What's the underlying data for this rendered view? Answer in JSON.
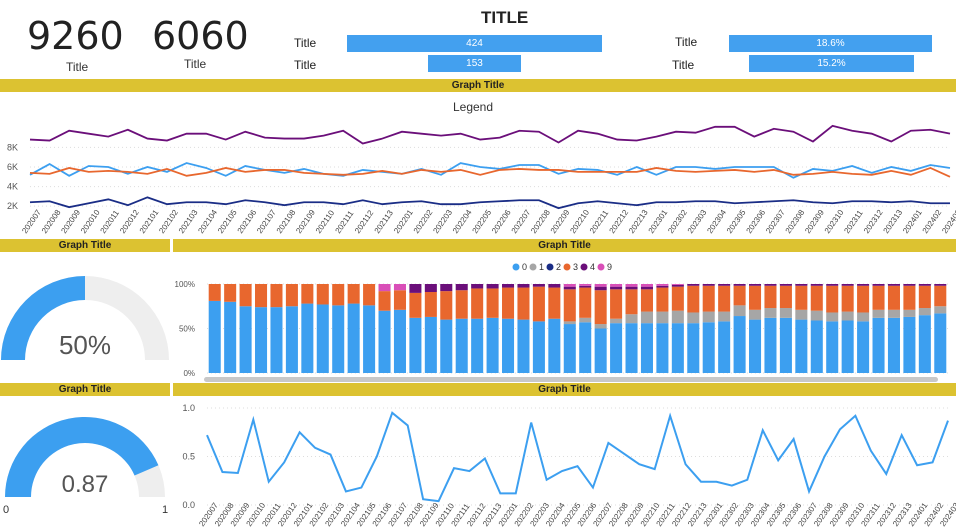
{
  "header": {
    "main_title": "TITLE",
    "kpis": [
      {
        "value": "9260",
        "label": "Title"
      },
      {
        "value": "6060",
        "label": "Title"
      }
    ],
    "metrics": [
      {
        "label": "Title",
        "value_text": "424",
        "share": 0.91
      },
      {
        "label": "Title",
        "value_text": "153",
        "share": 0.33
      },
      {
        "label": "Title",
        "value_text": "18.6%",
        "share": 0.91
      },
      {
        "label": "Title",
        "value_text": "15.2%",
        "share": 0.74
      }
    ]
  },
  "colors": {
    "blue": "#3c9ff0",
    "orange": "#e8672e",
    "navy": "#1a2d86",
    "purple": "#6b0f7a",
    "gray": "#a6a6a6",
    "pink": "#d94fb8",
    "band": "#dcc231"
  },
  "panels": {
    "line_title": "Graph Title",
    "gauge1_title": "Graph Title",
    "stack_title": "Graph Title",
    "gauge2_title": "Graph Title",
    "line2_title": "Graph Title"
  },
  "gauge1": {
    "value": 0.5,
    "label": "50%"
  },
  "gauge2": {
    "value": 0.87,
    "label": "0.87",
    "min_label": "0",
    "max_label": "1"
  },
  "chart_data": [
    {
      "type": "line",
      "legend_title": "Legend",
      "x": [
        "202007",
        "202008",
        "202009",
        "202010",
        "202011",
        "202012",
        "202101",
        "202102",
        "202103",
        "202104",
        "202105",
        "202106",
        "202107",
        "202108",
        "202109",
        "202110",
        "202111",
        "202112",
        "202113",
        "202201",
        "202202",
        "202203",
        "202204",
        "202205",
        "202206",
        "202207",
        "202208",
        "202209",
        "202210",
        "202211",
        "202212",
        "202213",
        "202301",
        "202302",
        "202303",
        "202304",
        "202305",
        "202306",
        "202307",
        "202308",
        "202309",
        "202310",
        "202311",
        "202312",
        "202313",
        "202401",
        "202402",
        "202403"
      ],
      "y_ticks": [
        "2K",
        "4K",
        "6K",
        "8K"
      ],
      "ylim": [
        1200,
        11000
      ],
      "series": [
        {
          "color": "#6b0f7a",
          "values": [
            8800,
            8700,
            9700,
            9400,
            9100,
            9800,
            8900,
            8700,
            9400,
            9400,
            8800,
            9600,
            9000,
            8900,
            8900,
            9200,
            9700,
            8400,
            8900,
            9600,
            9400,
            9200,
            9400,
            8800,
            9000,
            9700,
            9600,
            8500,
            9700,
            9400,
            8800,
            8700,
            9100,
            9600,
            9500,
            10100,
            10100,
            9100,
            9900,
            9600,
            8600,
            10200,
            9700,
            9400,
            8600,
            9700,
            9800,
            9400
          ]
        },
        {
          "color": "#3c9ff0",
          "values": [
            5200,
            6300,
            5100,
            6100,
            6000,
            5300,
            6000,
            5500,
            6400,
            5900,
            5100,
            6100,
            5700,
            5400,
            5800,
            5300,
            5100,
            5700,
            5500,
            5300,
            5800,
            5200,
            6400,
            6000,
            5800,
            6200,
            6200,
            5300,
            5800,
            5700,
            5200,
            6000,
            5200,
            6000,
            6000,
            5800,
            6000,
            6000,
            6000,
            4900,
            5800,
            5600,
            6100,
            5400,
            6000,
            5600,
            6200,
            5900
          ]
        },
        {
          "color": "#e8672e",
          "values": [
            5400,
            5300,
            5900,
            5500,
            5600,
            5500,
            5300,
            5800,
            5100,
            5400,
            5900,
            5500,
            5700,
            5700,
            5400,
            5300,
            5200,
            5300,
            5600,
            5300,
            5700,
            5500,
            5700,
            5200,
            5700,
            5800,
            5700,
            5700,
            5500,
            5500,
            5500,
            5500,
            5900,
            5600,
            5500,
            5600,
            5700,
            5500,
            5700,
            5200,
            5300,
            5500,
            5300,
            5200,
            5600,
            5200,
            5900,
            5000
          ]
        },
        {
          "color": "#1a2d86",
          "values": [
            2400,
            2500,
            1900,
            2300,
            2700,
            2100,
            2900,
            2200,
            2400,
            2400,
            2200,
            2600,
            2400,
            2100,
            2400,
            2400,
            2200,
            2600,
            2200,
            2400,
            2500,
            2200,
            2200,
            2400,
            2500,
            2600,
            2600,
            1800,
            2300,
            2500,
            2300,
            2100,
            2400,
            2400,
            2500,
            2500,
            2300,
            2400,
            2500,
            2600,
            2400,
            2300,
            2500,
            2500,
            2400,
            2500,
            2300,
            2300
          ]
        }
      ]
    },
    {
      "type": "bar",
      "stacked": true,
      "legend": [
        "0",
        "1",
        "2",
        "3",
        "4",
        "9"
      ],
      "legend_colors": [
        "#3c9ff0",
        "#a6a6a6",
        "#1a2d86",
        "#e8672e",
        "#6b0f7a",
        "#d94fb8"
      ],
      "y_ticks": [
        "0%",
        "50%",
        "100%"
      ],
      "ylim": [
        0,
        100
      ],
      "series": [
        {
          "name": "0",
          "values": [
            81,
            80,
            75,
            74,
            74,
            75,
            78,
            77,
            76,
            78,
            76,
            70,
            71,
            62,
            63,
            60,
            61,
            61,
            62,
            61,
            60,
            58,
            61,
            55,
            57,
            50,
            56,
            56,
            56,
            56,
            56,
            56,
            57,
            58,
            64,
            60,
            62,
            62,
            60,
            59,
            58,
            59,
            58,
            62,
            62,
            63,
            65,
            67
          ]
        },
        {
          "name": "1",
          "values": [
            0,
            0,
            0,
            0,
            0,
            0,
            0,
            0,
            0,
            0,
            0,
            0,
            0,
            0,
            0,
            0,
            0,
            0,
            0,
            0,
            0,
            0,
            0,
            3,
            5,
            5,
            5,
            10,
            13,
            13,
            14,
            12,
            12,
            11,
            12,
            11,
            11,
            11,
            11,
            11,
            10,
            10,
            10,
            9,
            9,
            8,
            8,
            8
          ]
        },
        {
          "name": "2",
          "values": [
            0,
            0,
            0,
            0,
            0,
            0,
            0,
            0,
            0,
            0,
            0,
            0,
            0,
            0,
            0,
            0,
            0,
            0,
            0,
            0,
            0,
            0,
            0,
            0,
            0,
            0,
            0,
            0,
            0,
            0,
            0,
            0,
            0,
            0,
            0,
            0,
            0,
            0,
            0,
            0,
            0,
            0,
            0,
            0,
            0,
            0,
            0,
            0
          ]
        },
        {
          "name": "3",
          "values": [
            19,
            20,
            25,
            26,
            26,
            25,
            22,
            23,
            24,
            22,
            24,
            22,
            22,
            28,
            28,
            32,
            32,
            34,
            33,
            35,
            36,
            39,
            35,
            36,
            34,
            38,
            33,
            28,
            25,
            27,
            27,
            30,
            29,
            29,
            22,
            27,
            25,
            25,
            27,
            28,
            30,
            29,
            30,
            27,
            27,
            27,
            25,
            23
          ]
        },
        {
          "name": "4",
          "values": [
            0,
            0,
            0,
            0,
            0,
            0,
            0,
            0,
            0,
            0,
            0,
            0,
            0,
            10,
            9,
            8,
            7,
            5,
            5,
            4,
            4,
            3,
            4,
            3,
            2,
            4,
            3,
            3,
            3,
            2,
            2,
            2,
            2,
            2,
            2,
            2,
            2,
            2,
            2,
            2,
            2,
            2,
            2,
            2,
            2,
            2,
            2,
            2
          ]
        },
        {
          "name": "9",
          "values": [
            0,
            0,
            0,
            0,
            0,
            0,
            0,
            0,
            0,
            0,
            0,
            8,
            7,
            0,
            0,
            0,
            0,
            0,
            0,
            0,
            0,
            0,
            0,
            3,
            2,
            3,
            3,
            3,
            3,
            2,
            1,
            0,
            0,
            0,
            0,
            0,
            0,
            0,
            0,
            0,
            0,
            0,
            0,
            0,
            0,
            0,
            0,
            0
          ]
        }
      ]
    },
    {
      "type": "line",
      "x": [
        "202007",
        "202008",
        "202009",
        "202010",
        "202011",
        "202012",
        "202101",
        "202102",
        "202103",
        "202104",
        "202105",
        "202106",
        "202107",
        "202108",
        "202109",
        "202110",
        "202111",
        "202112",
        "202113",
        "202201",
        "202202",
        "202203",
        "202204",
        "202205",
        "202206",
        "202207",
        "202208",
        "202209",
        "202210",
        "202211",
        "202212",
        "202213",
        "202301",
        "202302",
        "202303",
        "202304",
        "202305",
        "202306",
        "202307",
        "202308",
        "202309",
        "202310",
        "202311",
        "202312",
        "202313",
        "202401",
        "202402",
        "202403"
      ],
      "y_ticks": [
        "0.0",
        "0.5",
        "1.0"
      ],
      "ylim": [
        0,
        1
      ],
      "series": [
        {
          "color": "#3c9ff0",
          "values": [
            0.72,
            0.34,
            0.33,
            0.88,
            0.24,
            0.44,
            0.75,
            0.59,
            0.52,
            0.14,
            0.18,
            0.5,
            0.95,
            0.82,
            0.06,
            0.04,
            0.38,
            0.35,
            0.48,
            0.12,
            0.12,
            0.85,
            0.26,
            0.35,
            0.4,
            0.18,
            0.64,
            0.53,
            0.42,
            0.37,
            0.92,
            0.42,
            0.24,
            0.24,
            0.2,
            0.26,
            0.77,
            0.46,
            0.68,
            0.14,
            0.5,
            0.78,
            0.92,
            0.56,
            0.32,
            0.72,
            0.41,
            0.44,
            0.87
          ]
        }
      ]
    }
  ]
}
